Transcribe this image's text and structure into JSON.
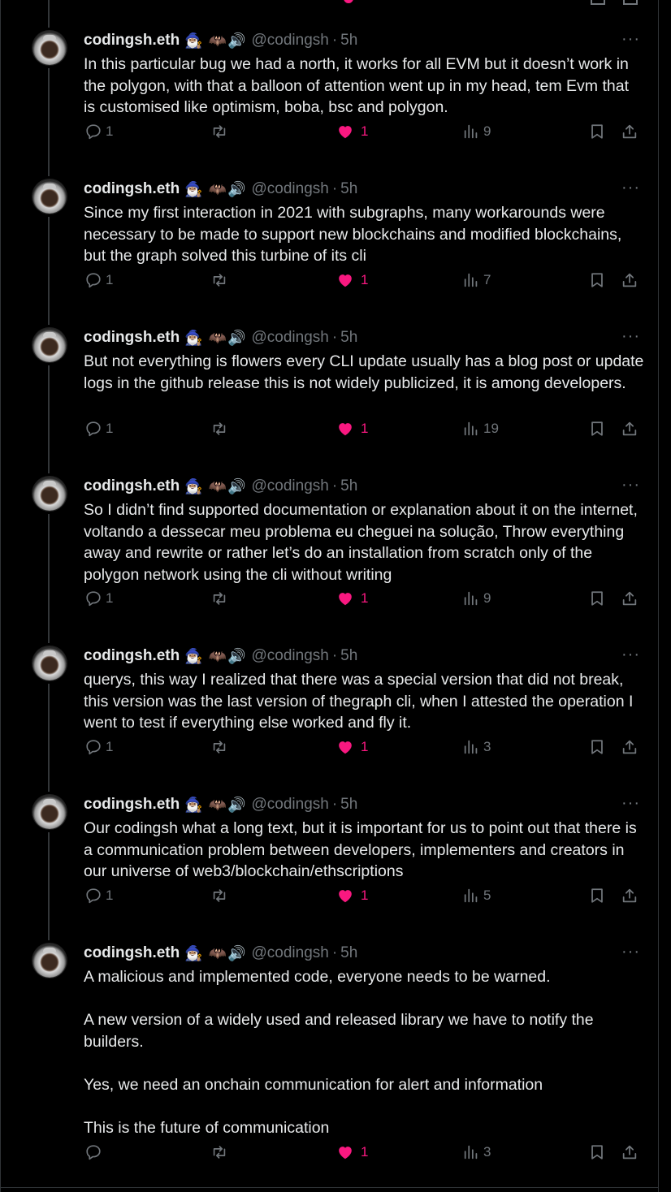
{
  "author": {
    "name": "codingsh.eth",
    "emojis": "🧙🏽‍♂️ 🦇🔊",
    "handle": "@codingsh",
    "separator": "·",
    "time": "5h"
  },
  "more_label": "···",
  "tweets": [
    {
      "paragraphs": [
        "In this particular bug we had a north, it works for all EVM but it doesn’t work in the polygon, with that a balloon of attention went up in my head, tem Evm that is customised like optimism, boba, bsc and polygon."
      ],
      "reply_count": "1",
      "like_count": "1",
      "view_count": "9"
    },
    {
      "paragraphs": [
        "Since my first interaction in 2021 with subgraphs, many workarounds were necessary to be made to support new blockchains and modified blockchains, but the graph solved this turbine of its cli"
      ],
      "reply_count": "1",
      "like_count": "1",
      "view_count": "7"
    },
    {
      "paragraphs": [
        "But not everything is flowers every CLI update usually has a blog post or update logs in the github release this is not widely publicized, it is among developers."
      ],
      "reply_count": "1",
      "like_count": "1",
      "view_count": "19"
    },
    {
      "paragraphs": [
        "So I didn’t find supported documentation or explanation about it on the internet, voltando a dessecar meu problema eu cheguei na solução, Throw everything away and rewrite or rather let’s do an installation from scratch only of the polygon network using the cli without writing"
      ],
      "reply_count": "1",
      "like_count": "1",
      "view_count": "9"
    },
    {
      "paragraphs": [
        "querys, this way I realized that there was a special version that did not break, this version was the last version of thegraph cli, when I attested the operation I went to test if everything else worked and fly it."
      ],
      "reply_count": "1",
      "like_count": "1",
      "view_count": "3"
    },
    {
      "paragraphs": [
        "Our codingsh what a long text, but it is important for us to point out that there is a communication problem between developers, implementers and creators in our universe of web3/blockchain/ethscriptions"
      ],
      "reply_count": "1",
      "like_count": "1",
      "view_count": "5"
    },
    {
      "paragraphs": [
        "A malicious and implemented code, everyone needs to be warned.",
        "A new version of a widely used and released library we have to notify the builders.",
        "Yes, we need an onchain communication for alert and information",
        "This is the future of communication"
      ],
      "reply_count": "",
      "like_count": "1",
      "view_count": "3"
    }
  ],
  "colors": {
    "background": "#000000",
    "text": "#e7e9ea",
    "muted": "#71767b",
    "like": "#f91880",
    "thread_line": "#333639"
  },
  "icons": {
    "reply": "reply-bubble-icon",
    "retweet": "retweet-icon",
    "like": "heart-filled-icon",
    "views": "views-bar-chart-icon",
    "bookmark": "bookmark-icon",
    "share": "share-upload-icon",
    "more": "more-dots-icon"
  }
}
